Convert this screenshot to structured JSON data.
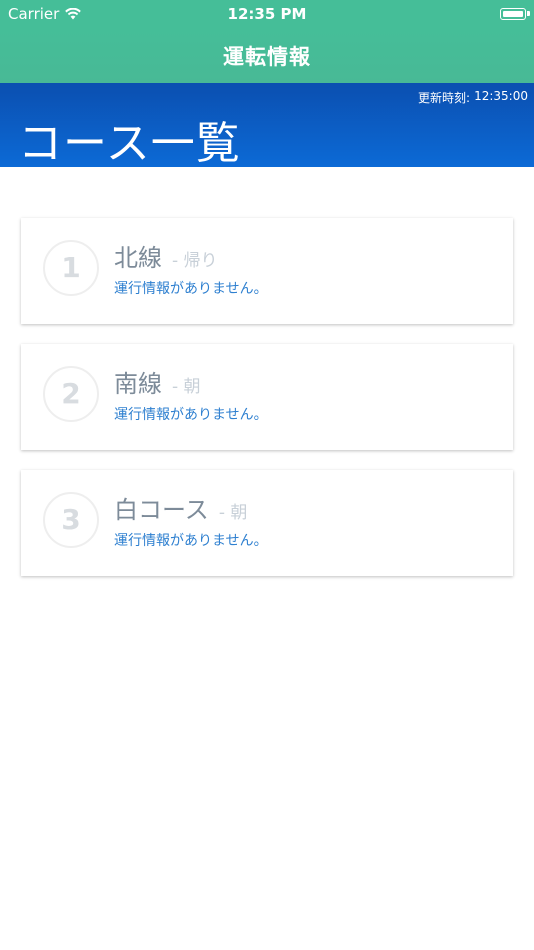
{
  "status_bar": {
    "carrier": "Carrier",
    "time": "12:35 PM",
    "icons": [
      "wifi-icon",
      "battery-icon"
    ]
  },
  "nav": {
    "title": "運転情報"
  },
  "header": {
    "updated_label": "更新時刻:",
    "updated_time": "12:35:00",
    "title": "コース一覧"
  },
  "courses": [
    {
      "number": "1",
      "name": "北線",
      "direction": "- 帰り",
      "status": "運行情報がありません。"
    },
    {
      "number": "2",
      "name": "南線",
      "direction": "- 朝",
      "status": "運行情報がありません。"
    },
    {
      "number": "3",
      "name": "白コース",
      "direction": "- 朝",
      "status": "運行情報がありません。"
    }
  ],
  "colors": {
    "nav_green": "#45be98",
    "header_blue": "#0b5ec4",
    "status_link": "#2f80d0"
  }
}
